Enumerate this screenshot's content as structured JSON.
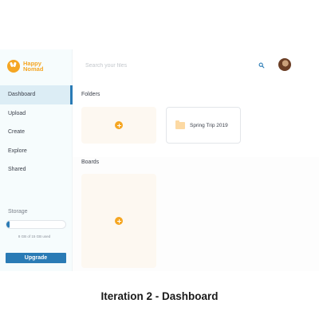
{
  "brand": {
    "name": "Happy Nomad",
    "logo_icon": "smile-hands-logo",
    "accent": "#f5a623"
  },
  "sidebar": {
    "items": [
      {
        "label": "Dashboard",
        "active": true
      },
      {
        "label": "Upload",
        "active": false
      },
      {
        "label": "Create",
        "active": false
      },
      {
        "label": "Explore",
        "active": false
      },
      {
        "label": "Shared",
        "active": false
      }
    ],
    "storage": {
      "label": "Storage",
      "usage_text": "8 GB of 15 GB used",
      "used_fraction": 0.0533
    },
    "upgrade_label": "Upgrade",
    "primary_color": "#2a7bb5"
  },
  "header": {
    "search": {
      "placeholder": "Search your files",
      "value": ""
    },
    "search_icon": "search-icon",
    "avatar": "user-avatar"
  },
  "main": {
    "folders": {
      "title": "Folders",
      "items": [
        {
          "name": "Spring Trip 2019",
          "icon": "folder-icon"
        }
      ]
    },
    "boards": {
      "title": "Boards"
    }
  },
  "caption": "Iteration 2 - Dashboard"
}
